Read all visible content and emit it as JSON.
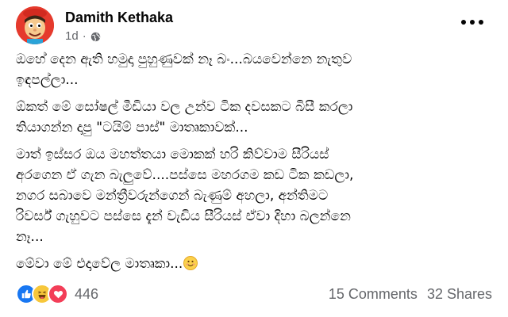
{
  "post": {
    "author": "Damith Kethaka",
    "time": "1d",
    "dot": "·",
    "paragraphs": [
      [
        "ඔහේ දෙන ඇති හමුදා පුහුණුවක් නෑ බං...බයවෙන්නෙ නැතුව",
        "ඉඳපල්ලා..."
      ],
      [
        "ඕකත් මේ සෝෂල් මීඩියා වල උන්ව ටික දවසකට බිසී කරලා",
        "තියාගන්න දාපු \"ටයිම් පාස්\" මාතෘකාවක්..."
      ],
      [
        "මාත් ඉස්සර ඔය මහත්තයා මොකක් හරි කිව්වාම සීරියස්",
        "අරගෙන ඒ ගැන බැලුවේ....පස්සෙ මහරගම කඩ ටික කඩලා,",
        "නගර සබාවෙ මන්ත්‍රීවරුන්ගෙන් බැණුම් අහලා, අන්තිමට",
        "රිවර්ස් ගැහුවට පස්සෙ දැන් වැඩිය සීරියස් ඒවා දිහා බලන්නෙ",
        "නෑ..."
      ],
      [
        "මේවා මේ එදාවේල මාතෘකා..."
      ]
    ],
    "emoji": "smiling-face-emoji",
    "reaction_count": "446",
    "comments": "15 Comments",
    "shares": "32 Shares",
    "colors": {
      "like": "#1877f2",
      "haha": "#f7c73b",
      "love": "#f33e58",
      "meta": "#65676b"
    }
  }
}
